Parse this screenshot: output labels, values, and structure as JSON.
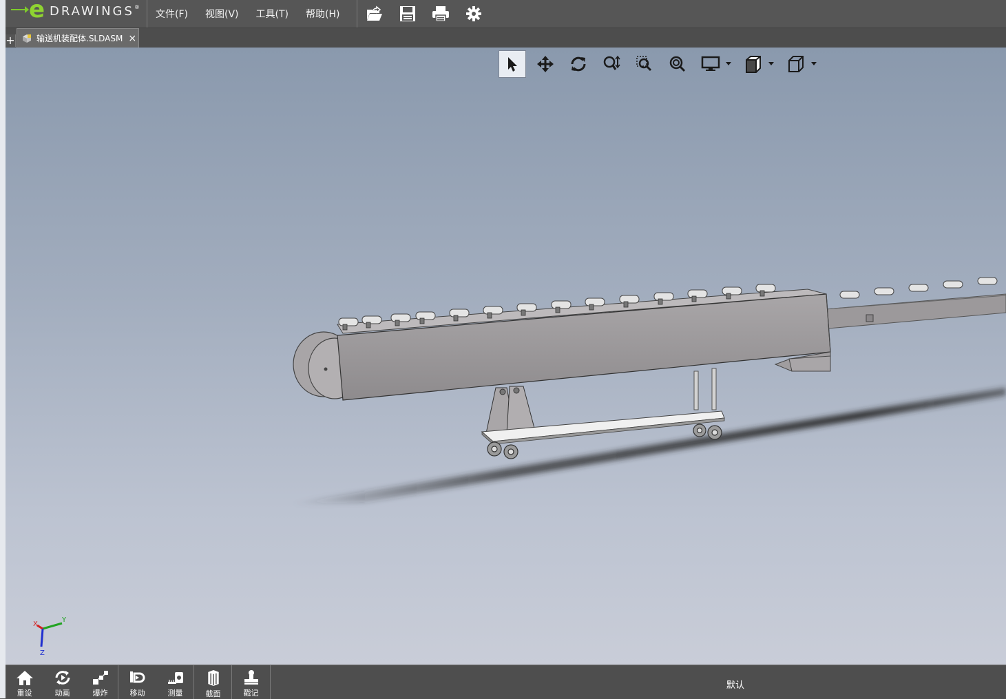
{
  "app": {
    "logo_text": "DRAWINGS",
    "logo_letter": "e",
    "logo_mark": "®"
  },
  "menu": {
    "items": [
      {
        "label": "文件(F)"
      },
      {
        "label": "视图(V)"
      },
      {
        "label": "工具(T)"
      },
      {
        "label": "帮助(H)"
      }
    ]
  },
  "top_icons": [
    "open-icon",
    "save-icon",
    "print-icon",
    "settings-icon"
  ],
  "tabs": {
    "plus": "+",
    "items": [
      {
        "label": "输送机装配体.SLDASM",
        "close": "×"
      }
    ]
  },
  "view_toolbar": [
    "select-icon",
    "pan-icon",
    "rotate-icon",
    "zoom-to-fit-icon",
    "zoom-to-area-icon",
    "zoom-icon",
    "display-style-icon",
    "view-orientation-icon",
    "standard-views-icon"
  ],
  "triad": {
    "x": "X",
    "y": "Y",
    "z": "Z"
  },
  "bottom_bar": {
    "buttons": [
      {
        "label": "重设",
        "icon": "home-icon"
      },
      {
        "label": "动画",
        "icon": "animate-icon"
      },
      {
        "label": "爆炸",
        "icon": "explode-icon"
      },
      {
        "label": "移动",
        "icon": "move-icon"
      },
      {
        "label": "测量",
        "icon": "measure-icon"
      },
      {
        "label": "截面",
        "icon": "section-icon"
      },
      {
        "label": "戳记",
        "icon": "stamp-icon"
      }
    ],
    "configuration": "默认"
  },
  "colors": {
    "accent": "#8fd331",
    "toolbar_bg": "#565656",
    "viewport_top": "#8a99ad",
    "viewport_bottom": "#c9cdd8"
  }
}
